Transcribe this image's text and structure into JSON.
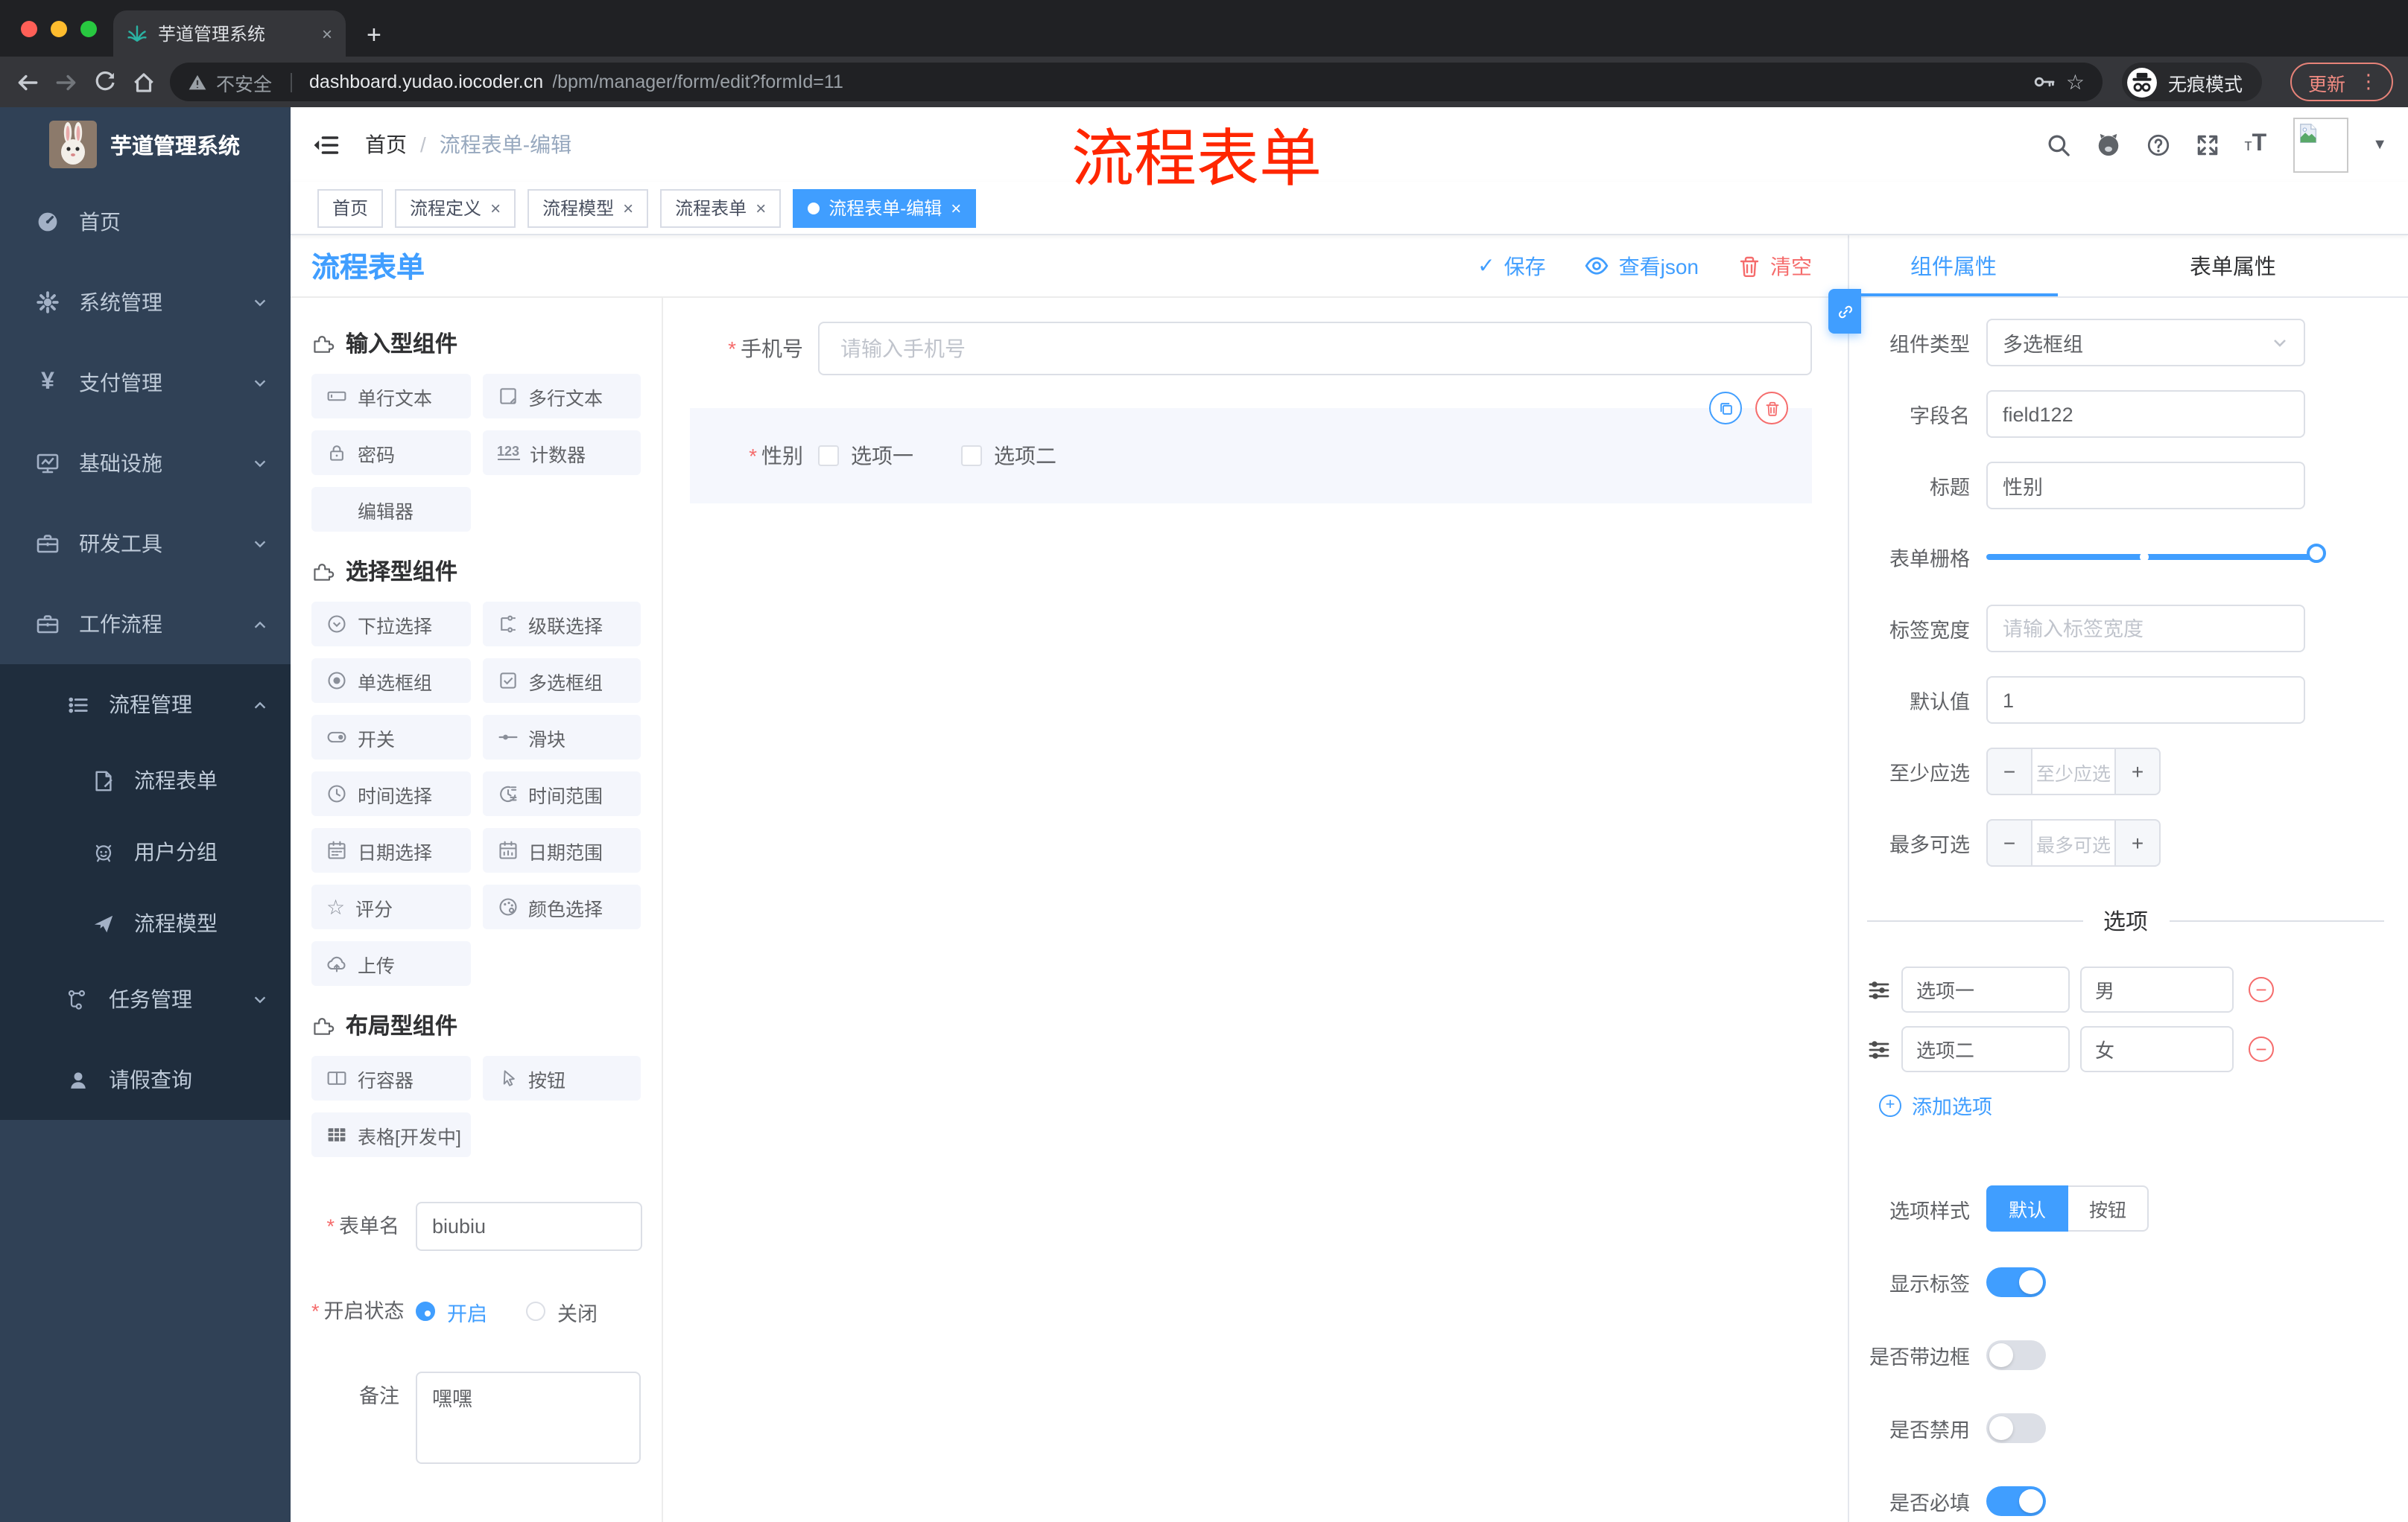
{
  "browser": {
    "tab_title": "芋道管理系统",
    "new_tab": "+",
    "close": "×",
    "security_label": "不安全",
    "url_domain": "dashboard.yudao.iocoder.cn",
    "url_path": "/bpm/manager/form/edit?formId=11",
    "incognito_label": "无痕模式",
    "update_label": "更新"
  },
  "sidebar": {
    "logo_title": "芋道管理系统",
    "items": [
      {
        "label": "首页"
      },
      {
        "label": "系统管理"
      },
      {
        "label": "支付管理"
      },
      {
        "label": "基础设施"
      },
      {
        "label": "研发工具"
      },
      {
        "label": "工作流程"
      },
      {
        "label": "流程管理"
      },
      {
        "label": "流程表单"
      },
      {
        "label": "用户分组"
      },
      {
        "label": "流程模型"
      },
      {
        "label": "任务管理"
      },
      {
        "label": "请假查询"
      }
    ]
  },
  "header": {
    "breadcrumb_home": "首页",
    "breadcrumb_sep": "/",
    "breadcrumb_current": "流程表单-编辑",
    "watermark": "流程表单"
  },
  "tags": [
    {
      "label": "首页"
    },
    {
      "label": "流程定义"
    },
    {
      "label": "流程模型"
    },
    {
      "label": "流程表单"
    },
    {
      "label": "流程表单-编辑"
    }
  ],
  "designer": {
    "title": "流程表单",
    "save": "保存",
    "view_json": "查看json",
    "clear": "清空",
    "sections": [
      {
        "title": "输入型组件",
        "items": [
          "单行文本",
          "多行文本",
          "密码",
          "计数器",
          "编辑器"
        ]
      },
      {
        "title": "选择型组件",
        "items": [
          "下拉选择",
          "级联选择",
          "单选框组",
          "多选框组",
          "开关",
          "滑块",
          "时间选择",
          "时间范围",
          "日期选择",
          "日期范围",
          "评分",
          "颜色选择",
          "上传"
        ]
      },
      {
        "title": "布局型组件",
        "items": [
          "行容器",
          "按钮",
          "表格[开发中]"
        ]
      }
    ],
    "meta": {
      "name_label": "表单名",
      "name_value": "biubiu",
      "status_label": "开启状态",
      "status_on": "开启",
      "status_off": "关闭",
      "remark_label": "备注",
      "remark_value": "嘿嘿"
    }
  },
  "canvas": {
    "phone_label": "手机号",
    "phone_placeholder": "请输入手机号",
    "gender_label": "性别",
    "gender_opt1": "选项一",
    "gender_opt2": "选项二"
  },
  "panel": {
    "tab_component": "组件属性",
    "tab_form": "表单属性",
    "type_label": "组件类型",
    "type_value": "多选框组",
    "field_label": "字段名",
    "field_value": "field122",
    "title_label": "标题",
    "title_value": "性别",
    "grid_label": "表单栅格",
    "width_label": "标签宽度",
    "width_placeholder": "请输入标签宽度",
    "default_label": "默认值",
    "default_value": "1",
    "min_label": "至少应选",
    "min_placeholder": "至少应选",
    "max_label": "最多可选",
    "max_placeholder": "最多可选",
    "options_title": "选项",
    "options": [
      {
        "name": "选项一",
        "value": "男"
      },
      {
        "name": "选项二",
        "value": "女"
      }
    ],
    "add_option": "添加选项",
    "style_label": "选项样式",
    "style_default": "默认",
    "style_button": "按钮",
    "switch_show_label": "显示标签",
    "switch_border": "是否带边框",
    "switch_disabled": "是否禁用",
    "switch_required": "是否必填"
  },
  "colors": {
    "accent": "#409eff",
    "danger": "#f56c6c",
    "watermark_red": "#ff2600",
    "sidebar_bg": "#304156",
    "submenu_bg": "#1f2d3d"
  }
}
